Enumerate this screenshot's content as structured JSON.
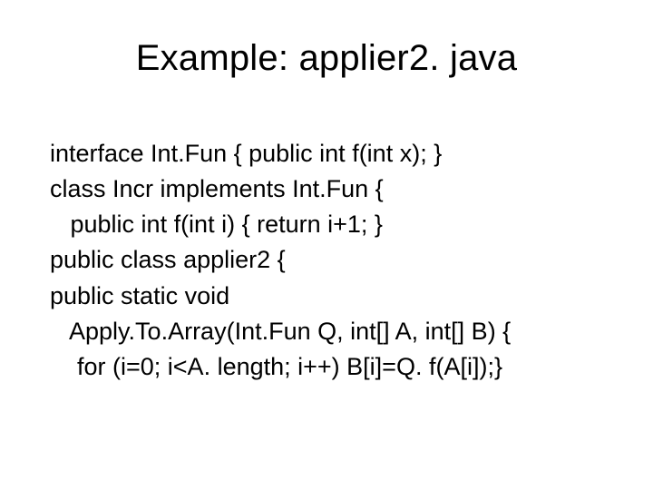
{
  "slide": {
    "title": "Example: applier2. java",
    "lines": [
      "interface Int.Fun { public int f(int x); }",
      "class Incr implements Int.Fun {",
      "   public int f(int i) { return i+1; }",
      "public class applier2 {",
      "public static void",
      "   Apply.To.Array(Int.Fun Q, int[] A, int[] B) {",
      "    for (i=0; i<A. length; i++) B[i]=Q. f(A[i]);}"
    ]
  }
}
